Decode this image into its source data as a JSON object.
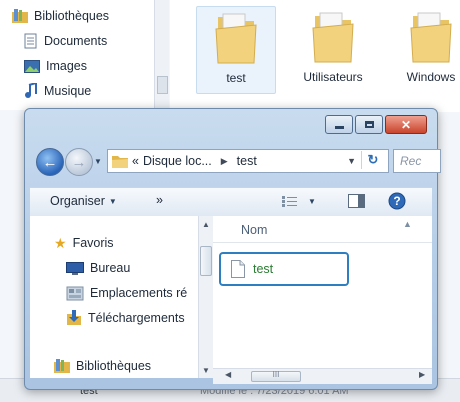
{
  "background": {
    "nav": [
      {
        "label": "Bibliothèques",
        "icon": "library-icon"
      },
      {
        "label": "Documents",
        "icon": "documents-icon"
      },
      {
        "label": "Images",
        "icon": "images-icon"
      },
      {
        "label": "Musique",
        "icon": "music-icon"
      }
    ],
    "tiles": [
      {
        "label": "test",
        "icon": "folder-icon"
      },
      {
        "label": "Utilisateurs",
        "icon": "folder-icon"
      },
      {
        "label": "Windows",
        "icon": "folder-icon"
      }
    ],
    "status": {
      "item_name": "test",
      "modified_text": "Modifié le : 7/23/2019 6:01 AM"
    }
  },
  "dialog": {
    "address": {
      "overflow": "«",
      "segments": [
        "Disque loc...",
        "test"
      ],
      "search_placeholder": "Rec"
    },
    "toolbar": {
      "organize_label": "Organiser",
      "more_label": "»"
    },
    "nav_pane": [
      {
        "label": "Favoris",
        "icon": "star-icon"
      },
      {
        "label": "Bureau",
        "icon": "desktop-icon"
      },
      {
        "label": "Emplacements ré",
        "icon": "recent-places-icon"
      },
      {
        "label": "Téléchargements",
        "icon": "downloads-icon"
      },
      {
        "label": "Bibliothèques",
        "icon": "library-icon"
      }
    ],
    "content": {
      "column_header": "Nom",
      "files": [
        {
          "name": "test",
          "icon": "text-file-icon"
        }
      ]
    },
    "hscroll_grip": "III"
  },
  "colors": {
    "selection_border": "#2d7fc1",
    "file_name": "#2a7d32",
    "close_button": "#c8442c"
  }
}
